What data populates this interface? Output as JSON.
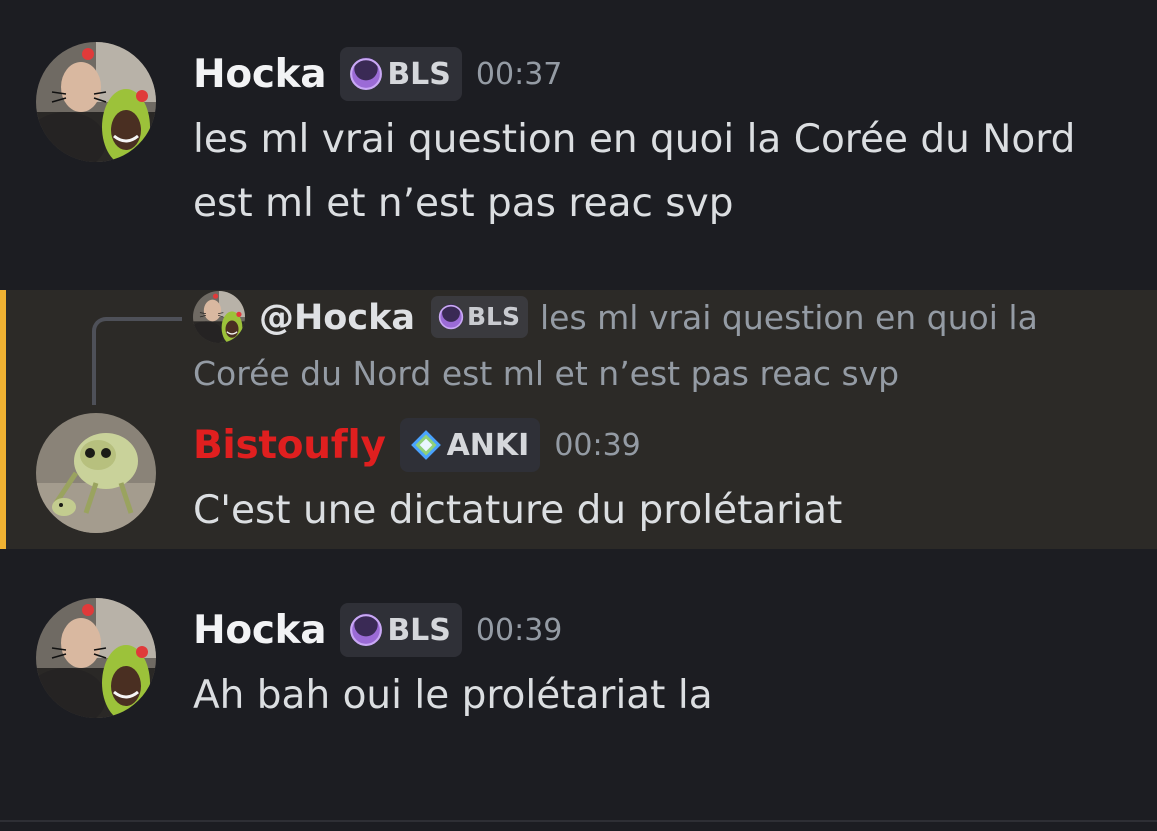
{
  "messages": [
    {
      "username": "Hocka",
      "tag": "BLS",
      "time": "00:37",
      "lines": [
        "les ml vrai question en quoi la Corée du Nord",
        "est ml et n’est pas reac svp"
      ]
    },
    {
      "reply": {
        "mention": "@Hocka",
        "tag": "BLS",
        "text": "les ml vrai question en quoi la Corée du Nord est ml et n’est pas reac svp"
      },
      "username": "Bistoufly",
      "tag": "ANKI",
      "time": "00:39",
      "lines": [
        "C'est une dictature du prolétariat"
      ]
    },
    {
      "username": "Hocka",
      "tag": "BLS",
      "time": "00:39",
      "lines": [
        "Ah bah oui le prolétariat la"
      ]
    }
  ],
  "icons": {
    "bls_tag": "purple-moon-icon",
    "anki_tag": "anki-diamond-icon"
  },
  "colors": {
    "background": "#1c1d22",
    "highlight_background": "#2c2a27",
    "highlight_bar": "#f0b232",
    "bistoufly_name": "#e01f1f",
    "bls_icon": "#9b6bd6"
  }
}
